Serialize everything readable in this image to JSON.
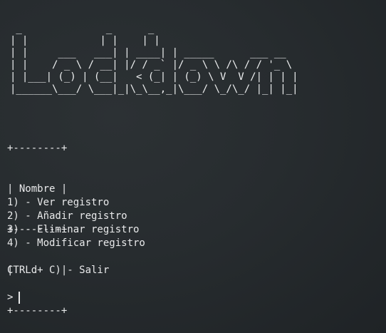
{
  "banner": {
    "ascii_art": " _              _      _\n| |            | |    | |\n| |     ___   ___| | ____| | _____      ___ __\n| |    / _ \\ / __| |/ / _` |/ _ \\ \\ /\\ / / '_ \\\n| |___| (_) | (__|   < (_| | (_) \\ V  V /| | | |\n|______\\___/ \\___|_|\\_\\__,_|\\___/ \\_/\\_/ |_| |_|"
  },
  "table": {
    "border_line": "+--------+",
    "header_row": "| Nombre |",
    "data_row": "|   d    |"
  },
  "menu": {
    "items": [
      "1) - Ver registro",
      "2) - Añadir registro",
      "3) - Eliminar registro",
      "4) - Modificar registro"
    ]
  },
  "exit_hint": "CTRL + C) - Salir",
  "prompt": {
    "symbol": ">",
    "input_value": ""
  },
  "colors": {
    "background": "#262b2e",
    "text": "#e9eaeb"
  }
}
